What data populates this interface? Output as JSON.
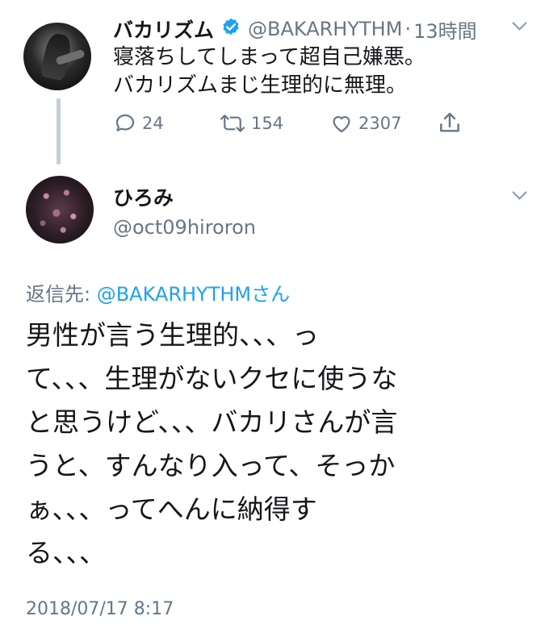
{
  "parent_tweet": {
    "name": "バカリズム",
    "handle": "@BAKARHYTHM",
    "time": "13時間",
    "separator": "·",
    "lines": [
      "寝落ちしてしまって超自己嫌悪。",
      "バカリズムまじ生理的に無理。"
    ],
    "replies": "24",
    "retweets": "154",
    "likes": "2307"
  },
  "reply_tweet": {
    "name": "ひろみ",
    "handle": "@oct09hiroron",
    "reply_prefix": "返信先: ",
    "reply_target": "@BAKARHYTHMさん",
    "lines": [
      "男性が言う生理的、、、っ",
      "て、、、生理がないクセに使うな",
      "と思うけど、、、バカリさんが言",
      "うと、すんなり入って、そっか",
      "ぁ、、、ってへんに納得す",
      "る、、、"
    ],
    "timestamp": "2018/07/17 8:17"
  },
  "colors": {
    "accent": "#1da1f2",
    "muted": "#657786",
    "text": "#14171a",
    "thread_line": "#c4cfd6"
  }
}
